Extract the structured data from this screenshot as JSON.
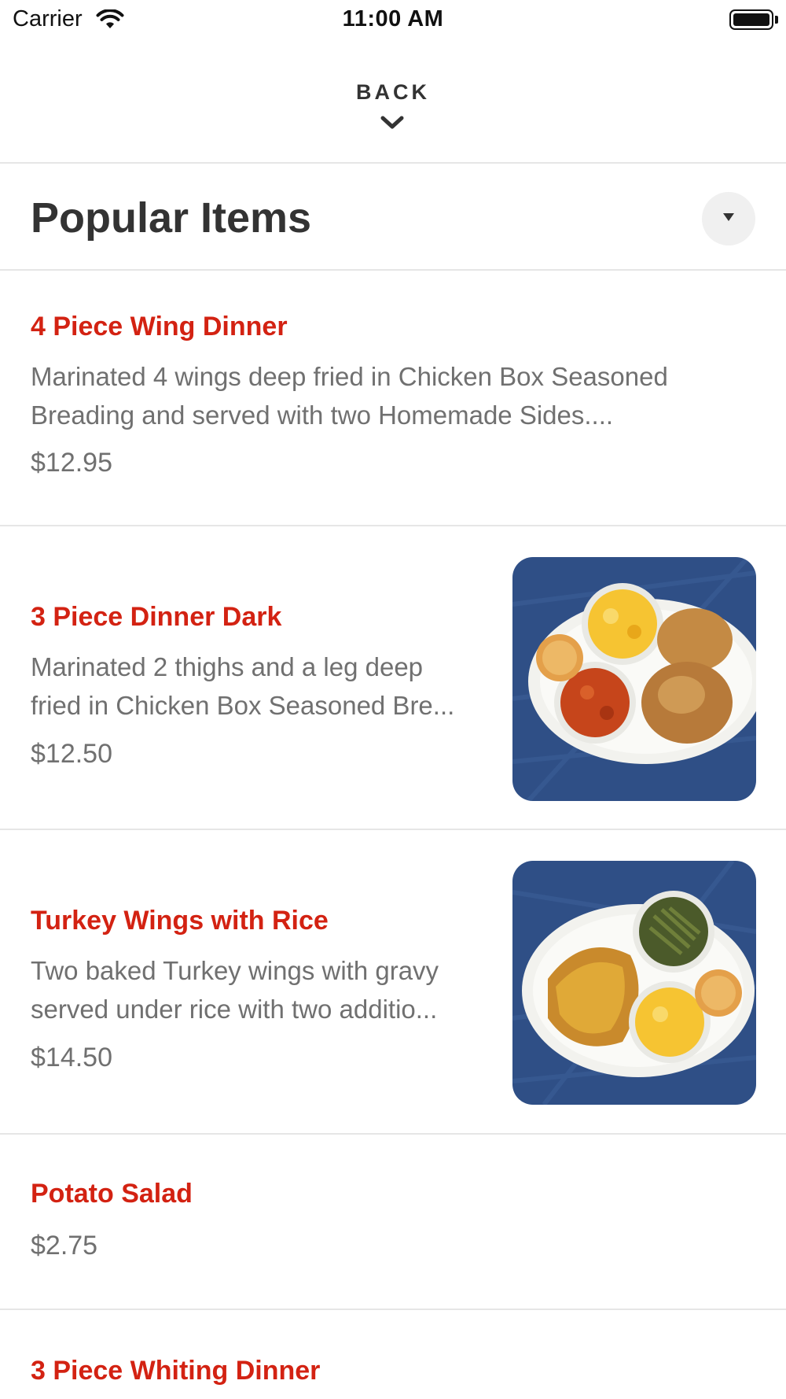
{
  "status_bar": {
    "carrier": "Carrier",
    "time": "11:00 AM"
  },
  "header": {
    "back_label": "BACK"
  },
  "section": {
    "title": "Popular Items"
  },
  "items": [
    {
      "name": "4 Piece Wing Dinner",
      "description_line1": "Marinated  4 wings deep fried in Chicken Box Seasoned",
      "description_line2": "Breading and served with two Homemade Sides....",
      "price": "$12.95"
    },
    {
      "name": "3 Piece Dinner Dark",
      "description_line1": "Marinated  2 thighs and a leg deep",
      "description_line2": "fried in Chicken Box Seasoned Bre...",
      "price": "$12.50"
    },
    {
      "name": "Turkey Wings with Rice",
      "description_line1": "Two baked Turkey wings with gravy",
      "description_line2": "served under rice with two additio...",
      "price": "$14.50"
    },
    {
      "name": "Potato Salad",
      "price": "$2.75"
    },
    {
      "name": "3 Piece Whiting Dinner"
    }
  ],
  "colors": {
    "accent": "#d32212",
    "text_primary": "#333333",
    "text_secondary": "#707070",
    "divider": "#e6e6e6",
    "photo_background": "#2f4f86"
  },
  "icons": {
    "wifi": "wifi-icon",
    "battery": "battery-icon",
    "back": "chevron-down-icon",
    "dropdown": "caret-down-icon"
  }
}
